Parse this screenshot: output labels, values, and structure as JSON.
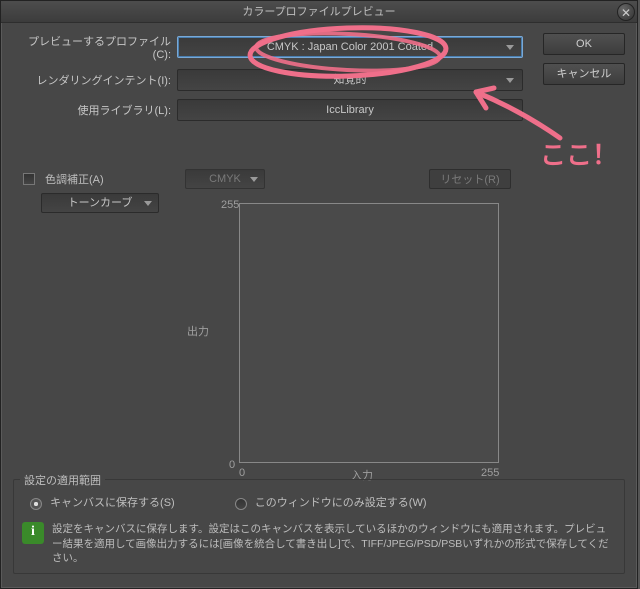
{
  "title": "カラープロファイルプレビュー",
  "buttons": {
    "ok": "OK",
    "cancel": "キャンセル",
    "reset": "リセット(R)"
  },
  "labels": {
    "profile": "プレビューするプロファイル(C):",
    "intent": "レンダリングインテント(I):",
    "library": "使用ライブラリ(L):",
    "tonecorrect": "色調補正(A)",
    "tonecurve": "トーンカーブ",
    "colormode": "CMYK",
    "output_axis": "出力",
    "input_axis": "入力",
    "ymax": "255",
    "ymin": "0",
    "xmin": "0",
    "xmax": "255"
  },
  "values": {
    "profile": "CMYK : Japan Color 2001 Coated",
    "intent": "知覚的",
    "library": "IccLibrary"
  },
  "scope": {
    "legend": "設定の適用範囲",
    "opt_canvas": "キャンバスに保存する(S)",
    "opt_window": "このウィンドウにのみ設定する(W)",
    "info": "設定をキャンバスに保存します。設定はこのキャンバスを表示しているほかのウィンドウにも適用されます。プレビュー結果を適用して画像出力するには[画像を統合して書き出し]で、TIFF/JPEG/PSD/PSBいずれかの形式で保存してください。"
  },
  "annotation": {
    "text": "ここ！",
    "color": "#ef6f8a"
  }
}
